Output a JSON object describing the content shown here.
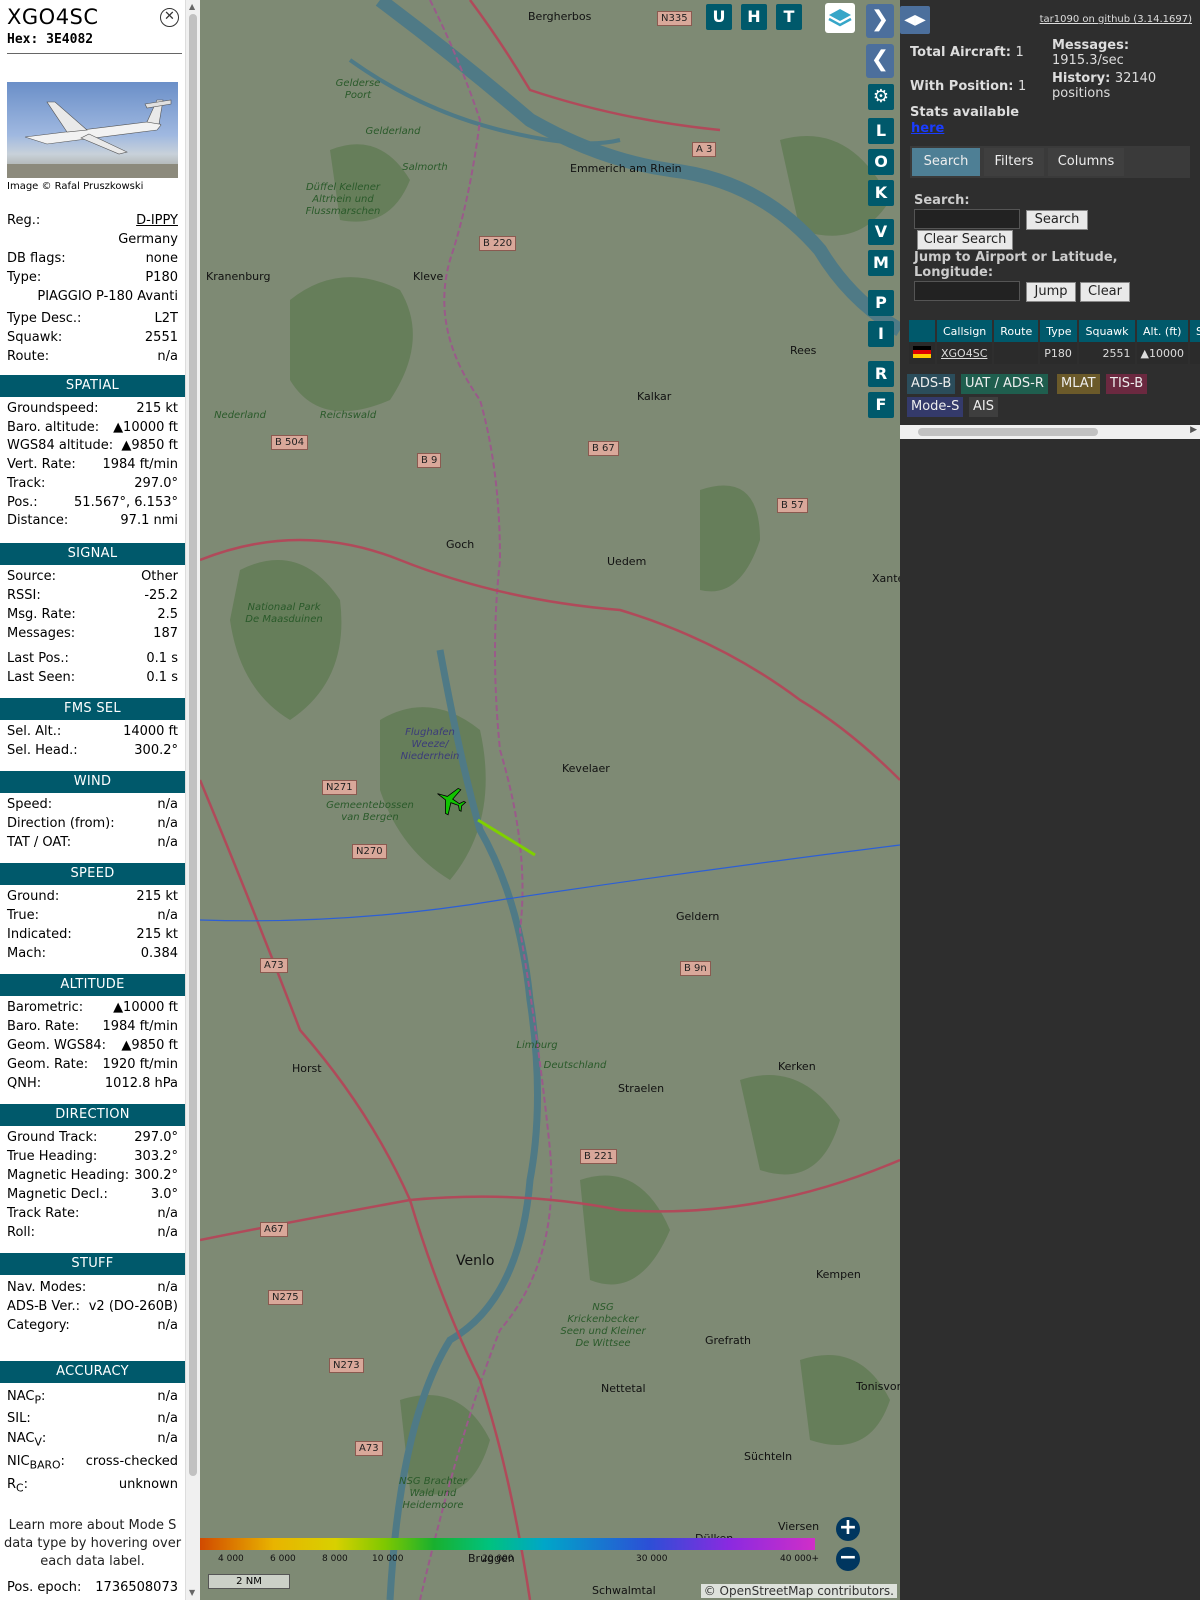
{
  "aircraft": {
    "callsign": "XGO4SC",
    "hex_label": "Hex: 3E4082",
    "photo_credit": "Image © Rafal Pruszkowski"
  },
  "info": {
    "reg_label": "Reg.:",
    "reg_value": "D-IPPY",
    "country": "Germany",
    "db_flags_label": "DB flags:",
    "db_flags_value": "none",
    "type_label": "Type:",
    "type_value": "P180",
    "type_name": "PIAGGIO P-180 Avanti",
    "type_desc_label": "Type Desc.:",
    "type_desc_value": "L2T",
    "squawk_label": "Squawk:",
    "squawk_value": "2551",
    "route_label": "Route:",
    "route_value": "n/a"
  },
  "sections": {
    "spatial": "SPATIAL",
    "signal": "SIGNAL",
    "fms_sel": "FMS SEL",
    "wind": "WIND",
    "speed": "SPEED",
    "altitude": "ALTITUDE",
    "direction": "DIRECTION",
    "stuff": "STUFF",
    "accuracy": "ACCURACY"
  },
  "spatial": [
    {
      "label": "Groundspeed:",
      "value": "215 kt"
    },
    {
      "label": "Baro. altitude:",
      "value": "▲10000 ft"
    },
    {
      "label": "WGS84 altitude:",
      "value": "▲9850 ft"
    },
    {
      "label": "Vert. Rate:",
      "value": "1984 ft/min"
    },
    {
      "label": "Track:",
      "value": "297.0°"
    },
    {
      "label": "Pos.:",
      "value": "51.567°, 6.153°"
    },
    {
      "label": "Distance:",
      "value": "97.1 nmi"
    }
  ],
  "signal": [
    {
      "label": "Source:",
      "value": "Other"
    },
    {
      "label": "RSSI:",
      "value": "-25.2"
    },
    {
      "label": "Msg. Rate:",
      "value": "2.5"
    },
    {
      "label": "Messages:",
      "value": "187"
    },
    {
      "label": "Last Pos.:",
      "value": "0.1 s"
    },
    {
      "label": "Last Seen:",
      "value": "0.1 s"
    }
  ],
  "fms_sel": [
    {
      "label": "Sel. Alt.:",
      "value": "14000 ft"
    },
    {
      "label": "Sel. Head.:",
      "value": "300.2°"
    }
  ],
  "wind": [
    {
      "label": "Speed:",
      "value": "n/a"
    },
    {
      "label": "Direction (from):",
      "value": "n/a"
    },
    {
      "label": "TAT / OAT:",
      "value": "n/a"
    }
  ],
  "speed": [
    {
      "label": "Ground:",
      "value": "215 kt"
    },
    {
      "label": "True:",
      "value": "n/a"
    },
    {
      "label": "Indicated:",
      "value": "215 kt"
    },
    {
      "label": "Mach:",
      "value": "0.384"
    }
  ],
  "altitude": [
    {
      "label": "Barometric:",
      "value": "▲10000 ft"
    },
    {
      "label": "Baro. Rate:",
      "value": "1984 ft/min"
    },
    {
      "label": "Geom. WGS84:",
      "value": "▲9850 ft"
    },
    {
      "label": "Geom. Rate:",
      "value": "1920 ft/min"
    },
    {
      "label": "QNH:",
      "value": "1012.8 hPa"
    }
  ],
  "direction": [
    {
      "label": "Ground Track:",
      "value": "297.0°"
    },
    {
      "label": "True Heading:",
      "value": "303.2°"
    },
    {
      "label": "Magnetic Heading:",
      "value": "300.2°"
    },
    {
      "label": "Magnetic Decl.:",
      "value": "3.0°"
    },
    {
      "label": "Track Rate:",
      "value": "n/a"
    },
    {
      "label": "Roll:",
      "value": "n/a"
    }
  ],
  "stuff": [
    {
      "label": "Nav. Modes:",
      "value": "n/a"
    },
    {
      "label": "ADS-B Ver.:",
      "value": "v2 (DO-260B)"
    },
    {
      "label": "Category:",
      "value": "n/a"
    }
  ],
  "accuracy": {
    "nacp_main": "NAC",
    "nacp_sub": "P",
    "nacp_value": "n/a",
    "sil_label": "SIL:",
    "sil_value": "n/a",
    "nacv_main": "NAC",
    "nacv_sub": "V",
    "nacv_value": "n/a",
    "nic_main": "NIC",
    "nic_sub": "BARO",
    "nic_value": "cross-checked",
    "rc_main": "R",
    "rc_sub": "C",
    "rc_value": "unknown"
  },
  "footer": {
    "learn_more": "Learn more about Mode S data type by hovering over each data label.",
    "epoch_label": "Pos. epoch:",
    "epoch_value": "1736508073"
  },
  "map": {
    "toolbar_u": "U",
    "toolbar_h": "H",
    "toolbar_t": "T",
    "side_buttons": [
      "L",
      "O",
      "K",
      "V",
      "M",
      "P",
      "I",
      "R",
      "F"
    ],
    "places": [
      "Bergherbos",
      "Emmerich am Rhein",
      "Kranenburg",
      "Kleve",
      "Rees",
      "Kalkar",
      "Goch",
      "Uedem",
      "Xante",
      "Kevelaer",
      "Geldern",
      "Straelen",
      "Kerken",
      "Horst",
      "Venlo",
      "Kempen",
      "Grefrath",
      "Nettetal",
      "Tonisvor",
      "Süchteln",
      "Viersen",
      "Dülken",
      "Schwalmtal",
      "Bruggen"
    ],
    "nature": [
      "Gelderse Poort",
      "Düffel Kellener Altrhein und Flussmarschen",
      "Reichswald",
      "Nationaal Park De Maasduinen",
      "Flughafen Weeze/ Niederrhein",
      "Gemeentebossen van Bergen",
      "NSG Krickenbecker Seen und Kleiner De Wittsee",
      "NSG Brachter Wald und Heidemoore",
      "Salmorth",
      "Gelderland",
      "Nederland",
      "Limburg",
      "Deutschland"
    ],
    "roads": [
      "N335",
      "A 3",
      "B 220",
      "B 504",
      "B 9",
      "B 67",
      "B 57",
      "N271",
      "N270",
      "A73",
      "B 9n",
      "B 221",
      "A67",
      "N275",
      "N273",
      "A73"
    ],
    "altitude_scale": [
      "4 000",
      "6 000",
      "8 000",
      "10 000",
      "20 000",
      "30 000",
      "40 000+"
    ],
    "distance": "2 NM",
    "attribution": "© OpenStreetMap contributors."
  },
  "right": {
    "github": "tar1090 on github (3.14.1697)",
    "total_label": "Total Aircraft:",
    "total_value": "1",
    "messages_label": "Messages:",
    "messages_value": "1915.3/sec",
    "with_pos_label": "With Position:",
    "with_pos_value": "1",
    "history_label": "History:",
    "history_value": "32140 positions",
    "stats_label": "Stats available",
    "stats_link": "here",
    "tabs": [
      "Search",
      "Filters",
      "Columns"
    ],
    "search_label": "Search:",
    "search_btn": "Search",
    "clear_search_btn": "Clear Search",
    "jump_label": "Jump to Airport or Latitude, Longitude:",
    "jump_btn": "Jump",
    "clear_btn": "Clear",
    "columns": [
      "Callsign",
      "Route",
      "Type",
      "Squawk",
      "Alt. (ft)",
      "Spd"
    ],
    "row": {
      "callsign": "XGO4SC",
      "route": "",
      "type": "P180",
      "squawk": "2551",
      "alt": "▲10000"
    },
    "sources": [
      "ADS-B",
      "UAT / ADS-R",
      "MLAT",
      "TIS-B",
      "Mode-S",
      "AIS"
    ]
  },
  "colors": {
    "accent": "#00596b",
    "nav_blue": "#4c6f9c",
    "adsb": "#2b4d5b",
    "uat": "#1f5e4e",
    "mlat": "#6b5a2a",
    "tisb": "#6b2940",
    "modes": "#343a6b",
    "ais": "#3e3e3e"
  }
}
